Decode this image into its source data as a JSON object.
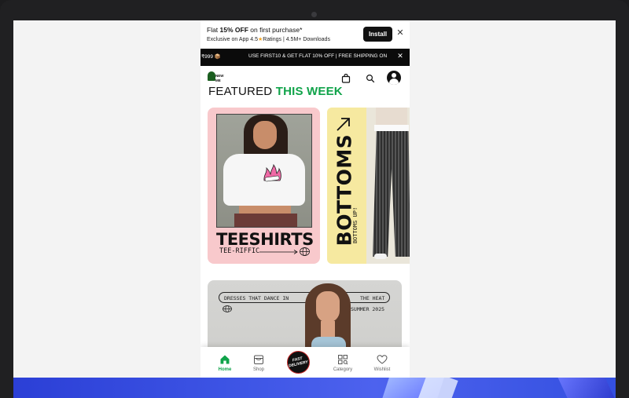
{
  "install_banner": {
    "offer_prefix": "Flat ",
    "offer_highlight": "15% OFF",
    "offer_suffix": " on first purchase*",
    "exclusive_prefix": "Exclusive on App 4.5",
    "star_glyph": "★",
    "exclusive_suffix": "Ratings | 4.5M+ Downloads",
    "install_label": "Install",
    "close_glyph": "✕"
  },
  "promo_strip": {
    "left_text": "₹999 📦",
    "text": "USE FIRST10 & GET FLAT 10% OFF | FREE SHIPPING ON",
    "close_glyph": "✕"
  },
  "header": {
    "logo_line1": "NEW",
    "logo_line2": "ME",
    "bag_icon": "shopping-bag-icon",
    "search_icon": "search-icon",
    "avatar_icon": "user-avatar-icon"
  },
  "featured": {
    "title_plain": "FEATURED ",
    "title_highlight": "THIS WEEK",
    "highlight_color": "#10a34a"
  },
  "cards": {
    "tees": {
      "title": "TEESHIRTS",
      "subtitle": "TEE-RIFFIC",
      "bg": "#f8c9cc"
    },
    "bottoms": {
      "title": "BOTTOMS",
      "subtitle": "BOTTOMS UP!",
      "bg": "#f6e9a0"
    },
    "summer": {
      "pill_left": "DRESSES THAT DANCE IN",
      "pill_right": "THE HEAT",
      "season": "SUMMER 2025"
    }
  },
  "bottom_nav": {
    "tabs": [
      {
        "label": "Home",
        "icon": "home-icon",
        "active": true
      },
      {
        "label": "Shop",
        "icon": "shop-icon",
        "active": false
      },
      {
        "label": "Category",
        "icon": "category-grid-icon",
        "active": false
      },
      {
        "label": "Wishlist",
        "icon": "heart-icon",
        "active": false
      }
    ],
    "fast_delivery_line1": "FAST",
    "fast_delivery_line2": "DELIVERY"
  }
}
